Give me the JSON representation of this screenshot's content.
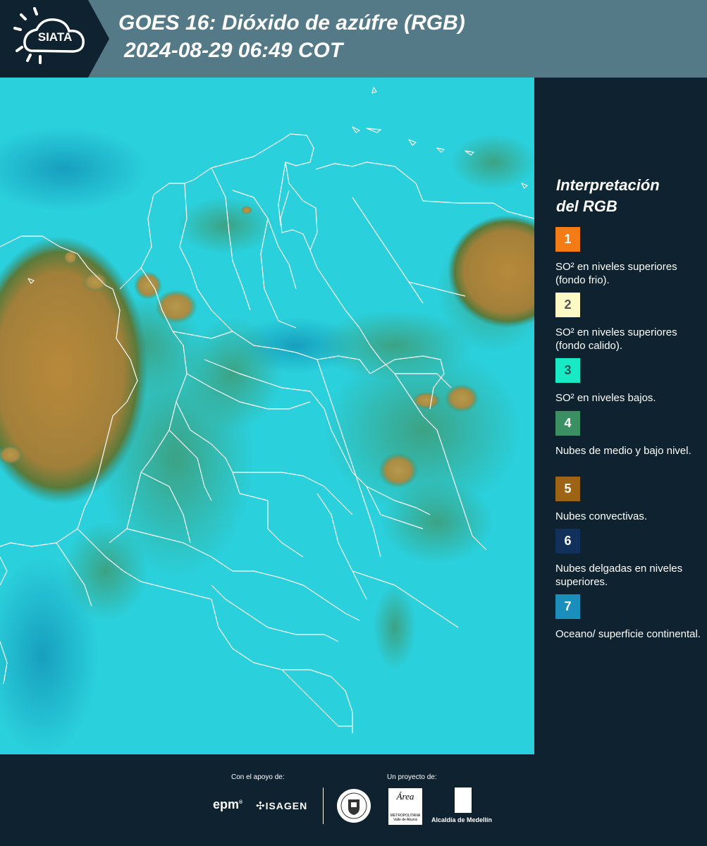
{
  "header": {
    "logo_text": "SIATA",
    "title_line1": "GOES 16: Dióxido de azúfre (RGB)",
    "title_line2": "2024-08-29 06:49 COT",
    "background_color": "#557a87"
  },
  "map": {
    "product": "SO2 RGB composite",
    "colors": {
      "surface": "#29d3dd",
      "mid_low_clouds": "#3a9a72",
      "convective": "#b08a3c",
      "boundaries": "#ffffff"
    }
  },
  "legend": {
    "title_line1": "Interpretación",
    "title_line2": "del RGB",
    "items": [
      {
        "number": "1",
        "text": "SO² en niveles superiores (fondo frio).",
        "color": "#f47c16",
        "number_color": "#ffffff"
      },
      {
        "number": "2",
        "text": "SO² en niveles superiores (fondo calido).",
        "color": "#fdf9c5",
        "number_color": "#555555"
      },
      {
        "number": "3",
        "text": "SO² en niveles bajos.",
        "color": "#18eac5",
        "number_color": "#1f5a55"
      },
      {
        "number": "4",
        "text": "Nubes de medio y bajo nivel.",
        "color": "#3a8f63",
        "number_color": "#ffffff"
      },
      {
        "number": "5",
        "text": "Nubes convectivas.",
        "color": "#9c6414",
        "number_color": "#ffffff"
      },
      {
        "number": "6",
        "text": "Nubes delgadas en niveles superiores.",
        "color": "#11305c",
        "number_color": "#ffffff"
      },
      {
        "number": "7",
        "text": "Oceano/ superficie continental.",
        "color": "#1a8fbc",
        "number_color": "#ffffff"
      }
    ]
  },
  "footer": {
    "support_caption": "Con el apoyo de:",
    "project_caption": "Un proyecto de:",
    "sponsors": [
      "epm",
      "ISAGEN"
    ],
    "partners": {
      "area": "Área",
      "area_sub": "METROPOLITANA Valle de Aburrá",
      "alcaldia": "Alcaldía de Medellín"
    }
  }
}
